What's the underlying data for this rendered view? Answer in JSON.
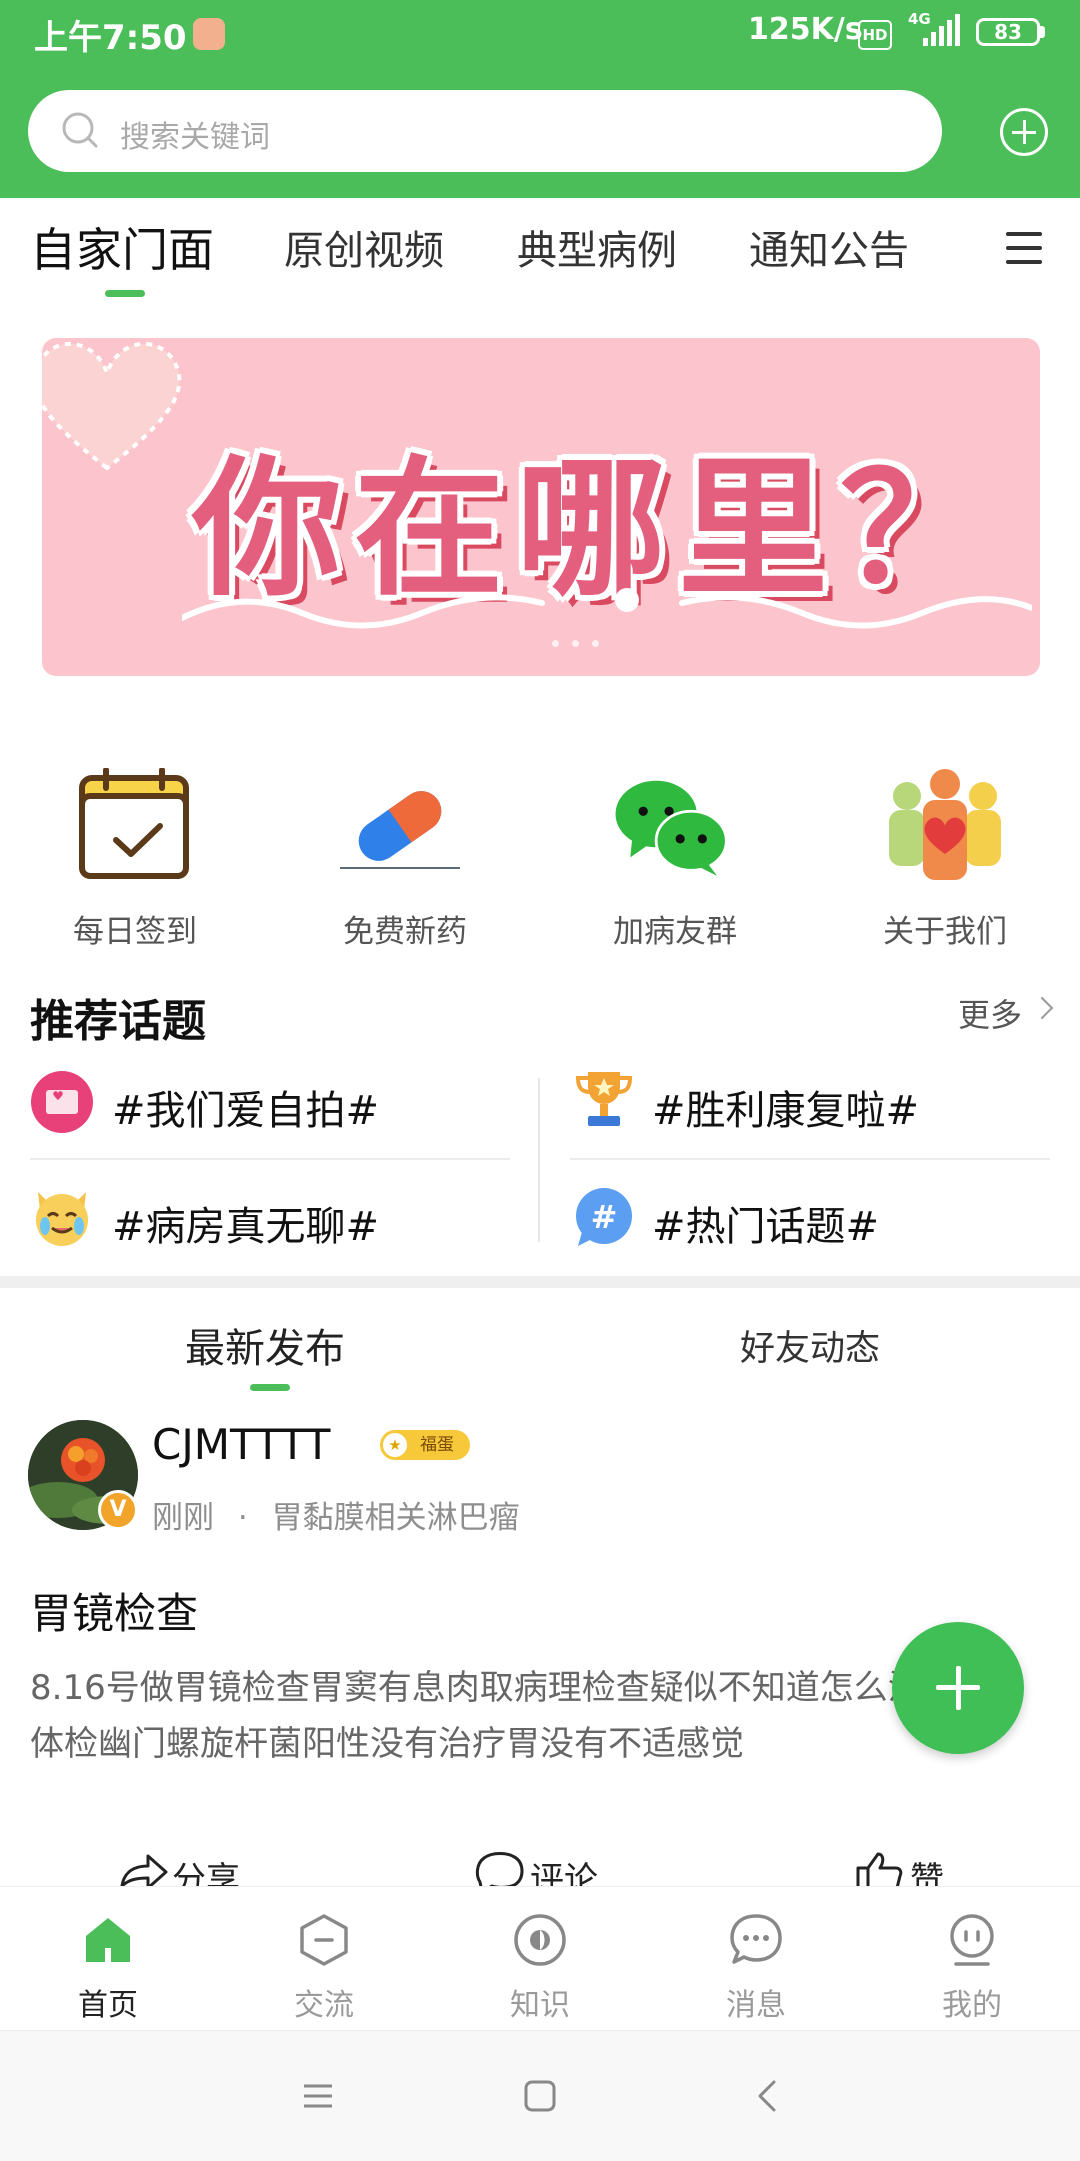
{
  "status_bar": {
    "time": "上午7:50",
    "network_speed": "125K/s",
    "hd": "HD",
    "network_type": "4G",
    "battery": "83"
  },
  "search": {
    "placeholder": "搜索关键词"
  },
  "tabs": [
    {
      "label": "自家门面",
      "active": true
    },
    {
      "label": "原创视频"
    },
    {
      "label": "典型病例"
    },
    {
      "label": "通知公告"
    }
  ],
  "banner": {
    "text": "你在哪里？"
  },
  "quick_actions": [
    {
      "label": "每日签到",
      "icon": "calendar-check-icon"
    },
    {
      "label": "免费新药",
      "icon": "pill-icon"
    },
    {
      "label": "加病友群",
      "icon": "wechat-icon"
    },
    {
      "label": "关于我们",
      "icon": "people-heart-icon"
    }
  ],
  "topics": {
    "title": "推荐话题",
    "more": "更多",
    "items": [
      {
        "label": "#我们爱自拍#",
        "icon": "selfie-icon"
      },
      {
        "label": "#胜利康复啦#",
        "icon": "trophy-icon"
      },
      {
        "label": "#病房真无聊#",
        "icon": "crying-cat-icon"
      },
      {
        "label": "#热门话题#",
        "icon": "hashtag-icon"
      }
    ]
  },
  "feed_tabs": [
    {
      "label": "最新发布",
      "active": true
    },
    {
      "label": "好友动态"
    }
  ],
  "post": {
    "username": "CJMTTTT",
    "badge": "福蛋",
    "time": "刚刚",
    "separator": "·",
    "category": "胃黏膜相关淋巴瘤",
    "title": "胃镜检查",
    "body": "8.16号做胃镜检查胃窦有息肉取病理检查疑似不知道怎么治疗去年体检幽门螺旋杆菌阳性没有治疗胃没有不适感觉",
    "actions": {
      "share": "分享",
      "comment": "评论",
      "like": "赞"
    }
  },
  "bottom_nav": [
    {
      "label": "首页",
      "icon": "home-icon",
      "active": true
    },
    {
      "label": "交流",
      "icon": "hexagon-icon"
    },
    {
      "label": "知识",
      "icon": "compass-icon"
    },
    {
      "label": "消息",
      "icon": "chat-bubble-icon"
    },
    {
      "label": "我的",
      "icon": "profile-icon"
    }
  ],
  "colors": {
    "accent": "#4cbe59",
    "banner_bg": "#fcc4cc",
    "banner_text": "#e35f7d"
  }
}
